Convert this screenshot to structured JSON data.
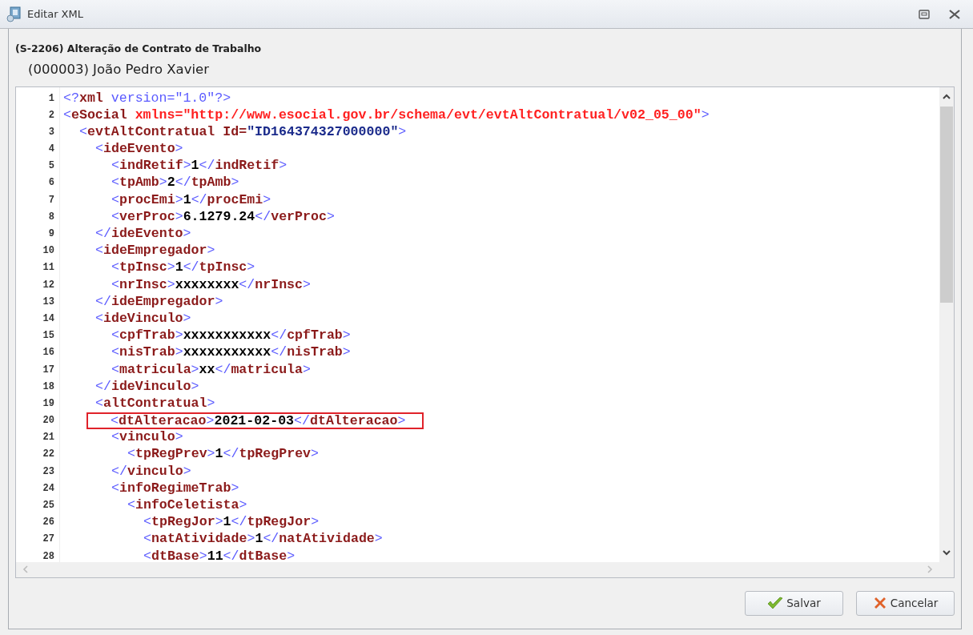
{
  "window": {
    "title": "Editar XML"
  },
  "header": {
    "event": "(S-2206) Alteração de Contrato de Trabalho",
    "employee": "(000003) João Pedro Xavier"
  },
  "editor": {
    "lines": [
      {
        "number": "1",
        "highlighted": false,
        "tokens": [
          {
            "kind": "bracket",
            "text": "<?"
          },
          {
            "kind": "decl",
            "text": "xml"
          },
          {
            "kind": "bracket",
            "text": " version=\"1.0\"?>"
          }
        ]
      },
      {
        "number": "2",
        "highlighted": false,
        "tokens": [
          {
            "kind": "bracket",
            "text": "<"
          },
          {
            "kind": "tag",
            "text": "eSocial"
          },
          {
            "kind": "ns",
            "text": " xmlns=\"http://www.esocial.gov.br/schema/evt/evtAltContratual/v02_05_00\""
          },
          {
            "kind": "bracket",
            "text": ">"
          }
        ],
        "children": [
          {
            "number": "3",
            "highlighted": false,
            "tokens": [
              {
                "kind": "bracket",
                "text": "<"
              },
              {
                "kind": "tag",
                "text": "evtAltContratual"
              },
              {
                "kind": "attr",
                "text": " Id="
              },
              {
                "kind": "string",
                "text": "\"ID164374327000000\""
              },
              {
                "kind": "bracket",
                "text": ">"
              }
            ],
            "children": [
              {
                "number": "4",
                "highlighted": false,
                "tokens": [
                  {
                    "kind": "bracket",
                    "text": "<"
                  },
                  {
                    "kind": "tag",
                    "text": "ideEvento"
                  },
                  {
                    "kind": "bracket",
                    "text": ">"
                  }
                ],
                "children": [
                  {
                    "number": "5",
                    "highlighted": false,
                    "tokens": [
                      {
                        "kind": "bracket",
                        "text": "<"
                      },
                      {
                        "kind": "tag",
                        "text": "indRetif"
                      },
                      {
                        "kind": "bracket",
                        "text": ">"
                      },
                      {
                        "kind": "content",
                        "text": "1"
                      },
                      {
                        "kind": "bracket",
                        "text": "</"
                      },
                      {
                        "kind": "tag",
                        "text": "indRetif"
                      },
                      {
                        "kind": "bracket",
                        "text": ">"
                      }
                    ]
                  },
                  {
                    "number": "6",
                    "highlighted": false,
                    "tokens": [
                      {
                        "kind": "bracket",
                        "text": "<"
                      },
                      {
                        "kind": "tag",
                        "text": "tpAmb"
                      },
                      {
                        "kind": "bracket",
                        "text": ">"
                      },
                      {
                        "kind": "content",
                        "text": "2"
                      },
                      {
                        "kind": "bracket",
                        "text": "</"
                      },
                      {
                        "kind": "tag",
                        "text": "tpAmb"
                      },
                      {
                        "kind": "bracket",
                        "text": ">"
                      }
                    ]
                  },
                  {
                    "number": "7",
                    "highlighted": false,
                    "tokens": [
                      {
                        "kind": "bracket",
                        "text": "<"
                      },
                      {
                        "kind": "tag",
                        "text": "procEmi"
                      },
                      {
                        "kind": "bracket",
                        "text": ">"
                      },
                      {
                        "kind": "content",
                        "text": "1"
                      },
                      {
                        "kind": "bracket",
                        "text": "</"
                      },
                      {
                        "kind": "tag",
                        "text": "procEmi"
                      },
                      {
                        "kind": "bracket",
                        "text": ">"
                      }
                    ]
                  },
                  {
                    "number": "8",
                    "highlighted": false,
                    "tokens": [
                      {
                        "kind": "bracket",
                        "text": "<"
                      },
                      {
                        "kind": "tag",
                        "text": "verProc"
                      },
                      {
                        "kind": "bracket",
                        "text": ">"
                      },
                      {
                        "kind": "content",
                        "text": "6.1279.24"
                      },
                      {
                        "kind": "bracket",
                        "text": "</"
                      },
                      {
                        "kind": "tag",
                        "text": "verProc"
                      },
                      {
                        "kind": "bracket",
                        "text": ">"
                      }
                    ]
                  }
                ]
              },
              {
                "number": "9",
                "highlighted": false,
                "tokens": [
                  {
                    "kind": "bracket",
                    "text": "</"
                  },
                  {
                    "kind": "tag",
                    "text": "ideEvento"
                  },
                  {
                    "kind": "bracket",
                    "text": ">"
                  }
                ]
              },
              {
                "number": "10",
                "highlighted": false,
                "tokens": [
                  {
                    "kind": "bracket",
                    "text": "<"
                  },
                  {
                    "kind": "tag",
                    "text": "ideEmpregador"
                  },
                  {
                    "kind": "bracket",
                    "text": ">"
                  }
                ],
                "children": [
                  {
                    "number": "11",
                    "highlighted": false,
                    "tokens": [
                      {
                        "kind": "bracket",
                        "text": "<"
                      },
                      {
                        "kind": "tag",
                        "text": "tpInsc"
                      },
                      {
                        "kind": "bracket",
                        "text": ">"
                      },
                      {
                        "kind": "content",
                        "text": "1"
                      },
                      {
                        "kind": "bracket",
                        "text": "</"
                      },
                      {
                        "kind": "tag",
                        "text": "tpInsc"
                      },
                      {
                        "kind": "bracket",
                        "text": ">"
                      }
                    ]
                  },
                  {
                    "number": "12",
                    "highlighted": false,
                    "tokens": [
                      {
                        "kind": "bracket",
                        "text": "<"
                      },
                      {
                        "kind": "tag",
                        "text": "nrInsc"
                      },
                      {
                        "kind": "bracket",
                        "text": ">"
                      },
                      {
                        "kind": "content",
                        "text": "xxxxxxxx"
                      },
                      {
                        "kind": "bracket",
                        "text": "</"
                      },
                      {
                        "kind": "tag",
                        "text": "nrInsc"
                      },
                      {
                        "kind": "bracket",
                        "text": ">"
                      }
                    ]
                  }
                ]
              },
              {
                "number": "13",
                "highlighted": false,
                "tokens": [
                  {
                    "kind": "bracket",
                    "text": "</"
                  },
                  {
                    "kind": "tag",
                    "text": "ideEmpregador"
                  },
                  {
                    "kind": "bracket",
                    "text": ">"
                  }
                ]
              },
              {
                "number": "14",
                "highlighted": false,
                "tokens": [
                  {
                    "kind": "bracket",
                    "text": "<"
                  },
                  {
                    "kind": "tag",
                    "text": "ideVinculo"
                  },
                  {
                    "kind": "bracket",
                    "text": ">"
                  }
                ],
                "children": [
                  {
                    "number": "15",
                    "highlighted": false,
                    "tokens": [
                      {
                        "kind": "bracket",
                        "text": "<"
                      },
                      {
                        "kind": "tag",
                        "text": "cpfTrab"
                      },
                      {
                        "kind": "bracket",
                        "text": ">"
                      },
                      {
                        "kind": "content",
                        "text": "xxxxxxxxxxx"
                      },
                      {
                        "kind": "bracket",
                        "text": "</"
                      },
                      {
                        "kind": "tag",
                        "text": "cpfTrab"
                      },
                      {
                        "kind": "bracket",
                        "text": ">"
                      }
                    ]
                  },
                  {
                    "number": "16",
                    "highlighted": false,
                    "tokens": [
                      {
                        "kind": "bracket",
                        "text": "<"
                      },
                      {
                        "kind": "tag",
                        "text": "nisTrab"
                      },
                      {
                        "kind": "bracket",
                        "text": ">"
                      },
                      {
                        "kind": "content",
                        "text": "xxxxxxxxxxx"
                      },
                      {
                        "kind": "bracket",
                        "text": "</"
                      },
                      {
                        "kind": "tag",
                        "text": "nisTrab"
                      },
                      {
                        "kind": "bracket",
                        "text": ">"
                      }
                    ]
                  },
                  {
                    "number": "17",
                    "highlighted": false,
                    "tokens": [
                      {
                        "kind": "bracket",
                        "text": "<"
                      },
                      {
                        "kind": "tag",
                        "text": "matricula"
                      },
                      {
                        "kind": "bracket",
                        "text": ">"
                      },
                      {
                        "kind": "content",
                        "text": "xx"
                      },
                      {
                        "kind": "bracket",
                        "text": "</"
                      },
                      {
                        "kind": "tag",
                        "text": "matricula"
                      },
                      {
                        "kind": "bracket",
                        "text": ">"
                      }
                    ]
                  }
                ]
              },
              {
                "number": "18",
                "highlighted": false,
                "tokens": [
                  {
                    "kind": "bracket",
                    "text": "</"
                  },
                  {
                    "kind": "tag",
                    "text": "ideVinculo"
                  },
                  {
                    "kind": "bracket",
                    "text": ">"
                  }
                ]
              },
              {
                "number": "19",
                "highlighted": false,
                "tokens": [
                  {
                    "kind": "bracket",
                    "text": "<"
                  },
                  {
                    "kind": "tag",
                    "text": "altContratual"
                  },
                  {
                    "kind": "bracket",
                    "text": ">"
                  }
                ],
                "children": [
                  {
                    "number": "20",
                    "highlighted": true,
                    "tokens": [
                      {
                        "kind": "bracket",
                        "text": "<"
                      },
                      {
                        "kind": "tag",
                        "text": "dtAlteracao"
                      },
                      {
                        "kind": "bracket",
                        "text": ">"
                      },
                      {
                        "kind": "content",
                        "text": "2021-02-03"
                      },
                      {
                        "kind": "bracket",
                        "text": "</"
                      },
                      {
                        "kind": "tag",
                        "text": "dtAlteracao"
                      },
                      {
                        "kind": "bracket",
                        "text": ">"
                      }
                    ]
                  },
                  {
                    "number": "21",
                    "highlighted": false,
                    "tokens": [
                      {
                        "kind": "bracket",
                        "text": "<"
                      },
                      {
                        "kind": "tag",
                        "text": "vinculo"
                      },
                      {
                        "kind": "bracket",
                        "text": ">"
                      }
                    ],
                    "children": [
                      {
                        "number": "22",
                        "highlighted": false,
                        "tokens": [
                          {
                            "kind": "bracket",
                            "text": "<"
                          },
                          {
                            "kind": "tag",
                            "text": "tpRegPrev"
                          },
                          {
                            "kind": "bracket",
                            "text": ">"
                          },
                          {
                            "kind": "content",
                            "text": "1"
                          },
                          {
                            "kind": "bracket",
                            "text": "</"
                          },
                          {
                            "kind": "tag",
                            "text": "tpRegPrev"
                          },
                          {
                            "kind": "bracket",
                            "text": ">"
                          }
                        ]
                      }
                    ]
                  },
                  {
                    "number": "23",
                    "highlighted": false,
                    "tokens": [
                      {
                        "kind": "bracket",
                        "text": "</"
                      },
                      {
                        "kind": "tag",
                        "text": "vinculo"
                      },
                      {
                        "kind": "bracket",
                        "text": ">"
                      }
                    ]
                  },
                  {
                    "number": "24",
                    "highlighted": false,
                    "tokens": [
                      {
                        "kind": "bracket",
                        "text": "<"
                      },
                      {
                        "kind": "tag",
                        "text": "infoRegimeTrab"
                      },
                      {
                        "kind": "bracket",
                        "text": ">"
                      }
                    ],
                    "children": [
                      {
                        "number": "25",
                        "highlighted": false,
                        "tokens": [
                          {
                            "kind": "bracket",
                            "text": "<"
                          },
                          {
                            "kind": "tag",
                            "text": "infoCeletista"
                          },
                          {
                            "kind": "bracket",
                            "text": ">"
                          }
                        ],
                        "children": [
                          {
                            "number": "26",
                            "highlighted": false,
                            "tokens": [
                              {
                                "kind": "bracket",
                                "text": "<"
                              },
                              {
                                "kind": "tag",
                                "text": "tpRegJor"
                              },
                              {
                                "kind": "bracket",
                                "text": ">"
                              },
                              {
                                "kind": "content",
                                "text": "1"
                              },
                              {
                                "kind": "bracket",
                                "text": "</"
                              },
                              {
                                "kind": "tag",
                                "text": "tpRegJor"
                              },
                              {
                                "kind": "bracket",
                                "text": ">"
                              }
                            ]
                          },
                          {
                            "number": "27",
                            "highlighted": false,
                            "tokens": [
                              {
                                "kind": "bracket",
                                "text": "<"
                              },
                              {
                                "kind": "tag",
                                "text": "natAtividade"
                              },
                              {
                                "kind": "bracket",
                                "text": ">"
                              },
                              {
                                "kind": "content",
                                "text": "1"
                              },
                              {
                                "kind": "bracket",
                                "text": "</"
                              },
                              {
                                "kind": "tag",
                                "text": "natAtividade"
                              },
                              {
                                "kind": "bracket",
                                "text": ">"
                              }
                            ]
                          },
                          {
                            "number": "28",
                            "highlighted": false,
                            "tokens": [
                              {
                                "kind": "bracket",
                                "text": "<"
                              },
                              {
                                "kind": "tag",
                                "text": "dtBase"
                              },
                              {
                                "kind": "bracket",
                                "text": ">"
                              },
                              {
                                "kind": "content",
                                "text": "11"
                              },
                              {
                                "kind": "bracket",
                                "text": "</"
                              },
                              {
                                "kind": "tag",
                                "text": "dtBase"
                              },
                              {
                                "kind": "bracket",
                                "text": ">"
                              }
                            ]
                          }
                        ]
                      }
                    ]
                  }
                ]
              }
            ]
          }
        ]
      }
    ]
  },
  "buttons": [
    {
      "kind": "save",
      "label": "Salvar"
    },
    {
      "kind": "cancel",
      "label": "Cancelar"
    }
  ]
}
